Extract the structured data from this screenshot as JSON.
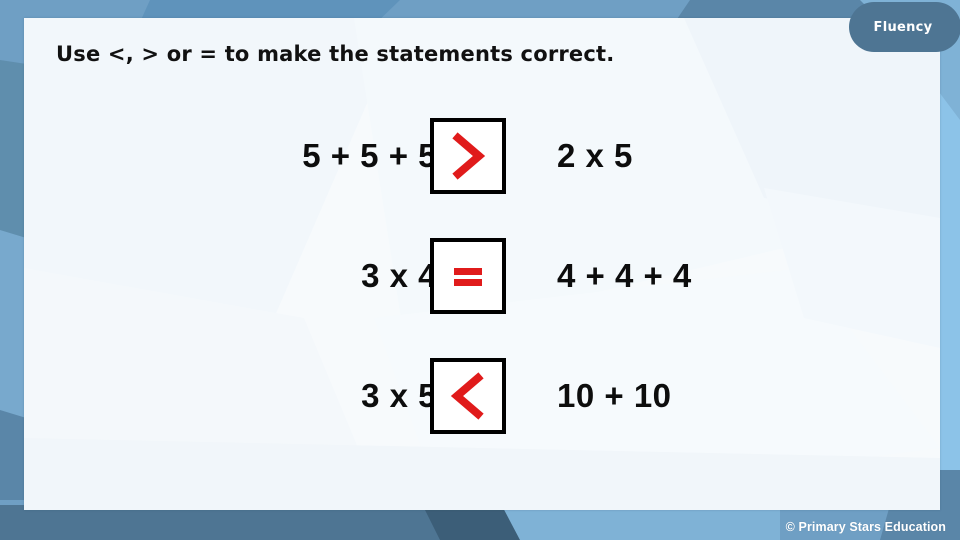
{
  "slide": {
    "title": "Use <, > or = to make the statements correct.",
    "badge_label": "Fluency",
    "footer_credit": "© Primary Stars Education"
  },
  "colors": {
    "accent_red": "#e01b1b",
    "badge_bg": "#4e7593",
    "card_bg": "#f7fafc",
    "outer_blue_light": "#8cc3e8",
    "outer_blue_mid": "#6f9fc4",
    "outer_blue_dark": "#4e7593",
    "box_border": "#000000",
    "text_dark": "#0d0d0d"
  },
  "statements": [
    {
      "left": "5 + 5 + 5",
      "symbol": "greater-than",
      "symbol_text": ">",
      "right": "2 x 5"
    },
    {
      "left": "3 x 4",
      "symbol": "equals",
      "symbol_text": "=",
      "right": "4 + 4 + 4"
    },
    {
      "left": "3 x 5",
      "symbol": "less-than",
      "symbol_text": "<",
      "right": "10 + 10"
    }
  ]
}
